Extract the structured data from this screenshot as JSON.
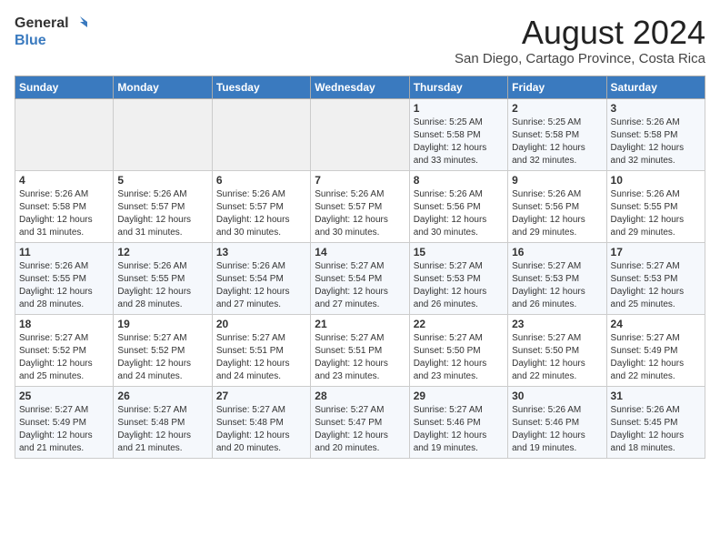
{
  "header": {
    "logo_general": "General",
    "logo_blue": "Blue",
    "title": "August 2024",
    "subtitle": "San Diego, Cartago Province, Costa Rica"
  },
  "weekdays": [
    "Sunday",
    "Monday",
    "Tuesday",
    "Wednesday",
    "Thursday",
    "Friday",
    "Saturday"
  ],
  "weeks": [
    [
      {
        "day": "",
        "empty": true
      },
      {
        "day": "",
        "empty": true
      },
      {
        "day": "",
        "empty": true
      },
      {
        "day": "",
        "empty": true
      },
      {
        "day": "1",
        "sunrise": "5:25 AM",
        "sunset": "5:58 PM",
        "daylight": "12 hours and 33 minutes."
      },
      {
        "day": "2",
        "sunrise": "5:25 AM",
        "sunset": "5:58 PM",
        "daylight": "12 hours and 32 minutes."
      },
      {
        "day": "3",
        "sunrise": "5:26 AM",
        "sunset": "5:58 PM",
        "daylight": "12 hours and 32 minutes."
      }
    ],
    [
      {
        "day": "4",
        "sunrise": "5:26 AM",
        "sunset": "5:58 PM",
        "daylight": "12 hours and 31 minutes."
      },
      {
        "day": "5",
        "sunrise": "5:26 AM",
        "sunset": "5:57 PM",
        "daylight": "12 hours and 31 minutes."
      },
      {
        "day": "6",
        "sunrise": "5:26 AM",
        "sunset": "5:57 PM",
        "daylight": "12 hours and 30 minutes."
      },
      {
        "day": "7",
        "sunrise": "5:26 AM",
        "sunset": "5:57 PM",
        "daylight": "12 hours and 30 minutes."
      },
      {
        "day": "8",
        "sunrise": "5:26 AM",
        "sunset": "5:56 PM",
        "daylight": "12 hours and 30 minutes."
      },
      {
        "day": "9",
        "sunrise": "5:26 AM",
        "sunset": "5:56 PM",
        "daylight": "12 hours and 29 minutes."
      },
      {
        "day": "10",
        "sunrise": "5:26 AM",
        "sunset": "5:55 PM",
        "daylight": "12 hours and 29 minutes."
      }
    ],
    [
      {
        "day": "11",
        "sunrise": "5:26 AM",
        "sunset": "5:55 PM",
        "daylight": "12 hours and 28 minutes."
      },
      {
        "day": "12",
        "sunrise": "5:26 AM",
        "sunset": "5:55 PM",
        "daylight": "12 hours and 28 minutes."
      },
      {
        "day": "13",
        "sunrise": "5:26 AM",
        "sunset": "5:54 PM",
        "daylight": "12 hours and 27 minutes."
      },
      {
        "day": "14",
        "sunrise": "5:27 AM",
        "sunset": "5:54 PM",
        "daylight": "12 hours and 27 minutes."
      },
      {
        "day": "15",
        "sunrise": "5:27 AM",
        "sunset": "5:53 PM",
        "daylight": "12 hours and 26 minutes."
      },
      {
        "day": "16",
        "sunrise": "5:27 AM",
        "sunset": "5:53 PM",
        "daylight": "12 hours and 26 minutes."
      },
      {
        "day": "17",
        "sunrise": "5:27 AM",
        "sunset": "5:53 PM",
        "daylight": "12 hours and 25 minutes."
      }
    ],
    [
      {
        "day": "18",
        "sunrise": "5:27 AM",
        "sunset": "5:52 PM",
        "daylight": "12 hours and 25 minutes."
      },
      {
        "day": "19",
        "sunrise": "5:27 AM",
        "sunset": "5:52 PM",
        "daylight": "12 hours and 24 minutes."
      },
      {
        "day": "20",
        "sunrise": "5:27 AM",
        "sunset": "5:51 PM",
        "daylight": "12 hours and 24 minutes."
      },
      {
        "day": "21",
        "sunrise": "5:27 AM",
        "sunset": "5:51 PM",
        "daylight": "12 hours and 23 minutes."
      },
      {
        "day": "22",
        "sunrise": "5:27 AM",
        "sunset": "5:50 PM",
        "daylight": "12 hours and 23 minutes."
      },
      {
        "day": "23",
        "sunrise": "5:27 AM",
        "sunset": "5:50 PM",
        "daylight": "12 hours and 22 minutes."
      },
      {
        "day": "24",
        "sunrise": "5:27 AM",
        "sunset": "5:49 PM",
        "daylight": "12 hours and 22 minutes."
      }
    ],
    [
      {
        "day": "25",
        "sunrise": "5:27 AM",
        "sunset": "5:49 PM",
        "daylight": "12 hours and 21 minutes."
      },
      {
        "day": "26",
        "sunrise": "5:27 AM",
        "sunset": "5:48 PM",
        "daylight": "12 hours and 21 minutes."
      },
      {
        "day": "27",
        "sunrise": "5:27 AM",
        "sunset": "5:48 PM",
        "daylight": "12 hours and 20 minutes."
      },
      {
        "day": "28",
        "sunrise": "5:27 AM",
        "sunset": "5:47 PM",
        "daylight": "12 hours and 20 minutes."
      },
      {
        "day": "29",
        "sunrise": "5:27 AM",
        "sunset": "5:46 PM",
        "daylight": "12 hours and 19 minutes."
      },
      {
        "day": "30",
        "sunrise": "5:26 AM",
        "sunset": "5:46 PM",
        "daylight": "12 hours and 19 minutes."
      },
      {
        "day": "31",
        "sunrise": "5:26 AM",
        "sunset": "5:45 PM",
        "daylight": "12 hours and 18 minutes."
      }
    ]
  ]
}
